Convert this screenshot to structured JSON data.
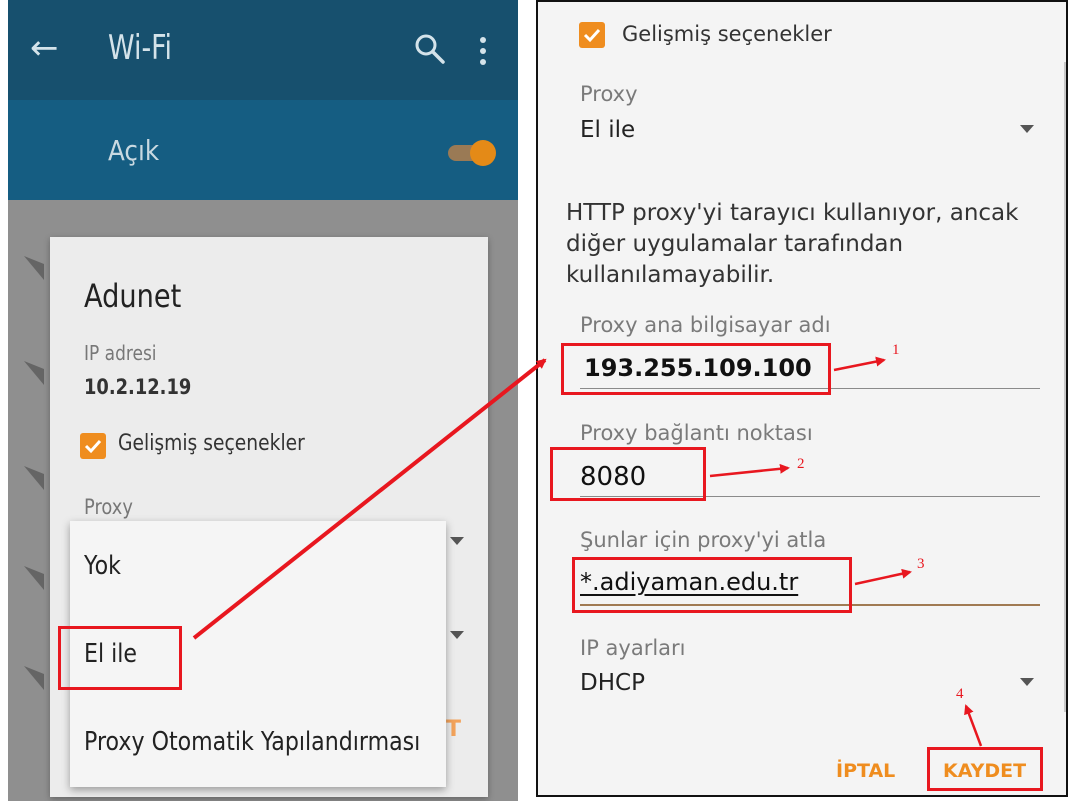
{
  "left_screen": {
    "appbar": {
      "title": "Wi-Fi"
    },
    "toggle_label": "Açık",
    "dialog": {
      "network_name": "Adunet",
      "ip_label": "IP adresi",
      "ip_value": "10.2.12.19",
      "advanced_label": "Gelişmiş seçenekler",
      "proxy_label": "Proxy",
      "partial_button": "T"
    },
    "proxy_menu": {
      "options": [
        "Yok",
        "El ile",
        "Proxy Otomatik Yapılandırması"
      ]
    }
  },
  "right_screen": {
    "advanced_label": "Gelişmiş seçenekler",
    "proxy_label": "Proxy",
    "proxy_value": "El ile",
    "info_text": "HTTP proxy'yi tarayıcı kullanıyor, ancak diğer uygulamalar tarafından kullanılamayabilir.",
    "host_label": "Proxy ana bilgisayar adı",
    "host_value": "193.255.109.100",
    "port_label": "Proxy bağlantı noktası",
    "port_value": "8080",
    "bypass_label": "Şunlar için proxy'yi atla",
    "bypass_value": "*.adiyaman.edu.tr",
    "ip_settings_label": "IP ayarları",
    "ip_settings_value": "DHCP",
    "cancel_label": "İPTAL",
    "save_label": "KAYDET"
  },
  "annotations": {
    "step1": "1",
    "step2": "2",
    "step3": "3",
    "step4": "4"
  },
  "colors": {
    "appbar": "#17506e",
    "toggle_bar": "#155d82",
    "accent": "#ef8d1f",
    "annotation": "#e8171f"
  },
  "icons": [
    "back-arrow-icon",
    "search-icon",
    "more-vert-icon",
    "wifi-icon",
    "checkbox-checked-icon",
    "dropdown-caret-icon"
  ]
}
